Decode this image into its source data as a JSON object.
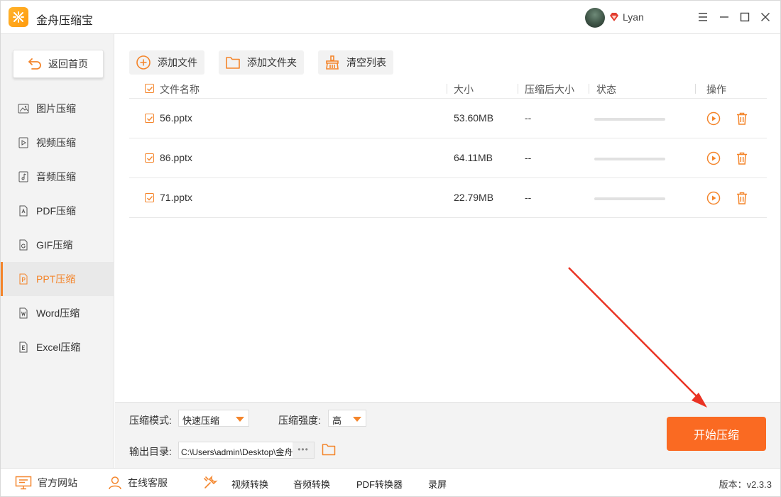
{
  "app": {
    "title": "金舟压缩宝",
    "user": "Lyan"
  },
  "sidebar": {
    "back_label": "返回首页",
    "items": [
      {
        "label": "图片压缩",
        "icon": "image-icon",
        "active": false
      },
      {
        "label": "视频压缩",
        "icon": "video-icon",
        "active": false
      },
      {
        "label": "音频压缩",
        "icon": "audio-icon",
        "active": false
      },
      {
        "label": "PDF压缩",
        "icon": "pdf-icon",
        "active": false
      },
      {
        "label": "GIF压缩",
        "icon": "gif-icon",
        "active": false
      },
      {
        "label": "PPT压缩",
        "icon": "ppt-icon",
        "active": true
      },
      {
        "label": "Word压缩",
        "icon": "word-icon",
        "active": false
      },
      {
        "label": "Excel压缩",
        "icon": "excel-icon",
        "active": false
      }
    ]
  },
  "toolbar": {
    "add_file": "添加文件",
    "add_folder": "添加文件夹",
    "clear_list": "清空列表"
  },
  "table": {
    "headers": {
      "name": "文件名称",
      "size": "大小",
      "compressed_size": "压缩后大小",
      "status": "状态",
      "action": "操作"
    },
    "rows": [
      {
        "name": "56.pptx",
        "size": "53.60MB",
        "compressed": "--",
        "progress": 0
      },
      {
        "name": "86.pptx",
        "size": "64.11MB",
        "compressed": "--",
        "progress": 0
      },
      {
        "name": "71.pptx",
        "size": "22.79MB",
        "compressed": "--",
        "progress": 0
      }
    ]
  },
  "settings": {
    "mode_label": "压缩模式:",
    "mode_value": "快速压缩",
    "strength_label": "压缩强度:",
    "strength_value": "高",
    "output_label": "输出目录:",
    "output_path": "C:\\Users\\admin\\Desktop\\金舟压缩宝",
    "browse_dots": "•••",
    "start_label": "开始压缩"
  },
  "footer": {
    "website": "官方网站",
    "service": "在线客服",
    "links": [
      "视频转换",
      "音频转换",
      "PDF转换器",
      "录屏"
    ],
    "version": "版本：v2.3.3"
  },
  "colors": {
    "accent": "#f4852b",
    "start_button": "#fa6a22",
    "arrow": "#ea3323"
  }
}
